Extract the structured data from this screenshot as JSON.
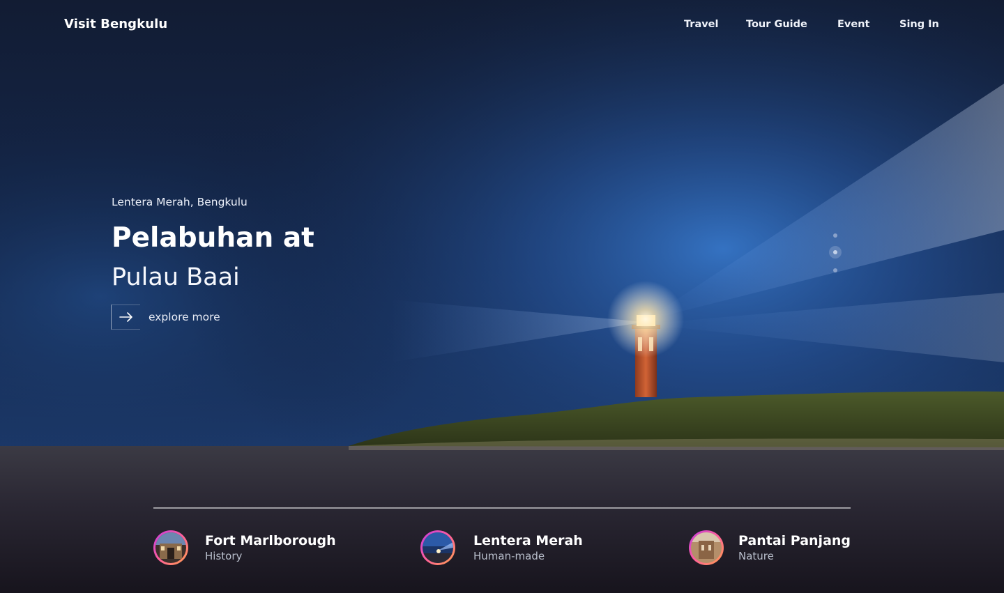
{
  "header": {
    "brand": "Visit Bengkulu",
    "nav": [
      "Travel",
      "Tour Guide",
      "Event",
      "Sing In"
    ]
  },
  "hero": {
    "location": "Lentera Merah, Bengkulu",
    "title": "Pelabuhan at",
    "subtitle": "Pulau Baai",
    "cta": "explore more",
    "cta_icon": "arrow-right-icon"
  },
  "slider": {
    "dot_count": 3,
    "active_index": 1
  },
  "destinations": [
    {
      "name": "Fort Marlborough",
      "category": "History"
    },
    {
      "name": "Lentera Merah",
      "category": "Human-made"
    },
    {
      "name": "Pantai Panjang",
      "category": "Nature"
    }
  ],
  "colors": {
    "sky_dark": "#0e1a33",
    "sky_blue": "#2f6fc4",
    "lighthouse": "#c2552e",
    "avatar_ring": [
      "#c13ae0",
      "#ff5f9a",
      "#ffa24a"
    ]
  }
}
